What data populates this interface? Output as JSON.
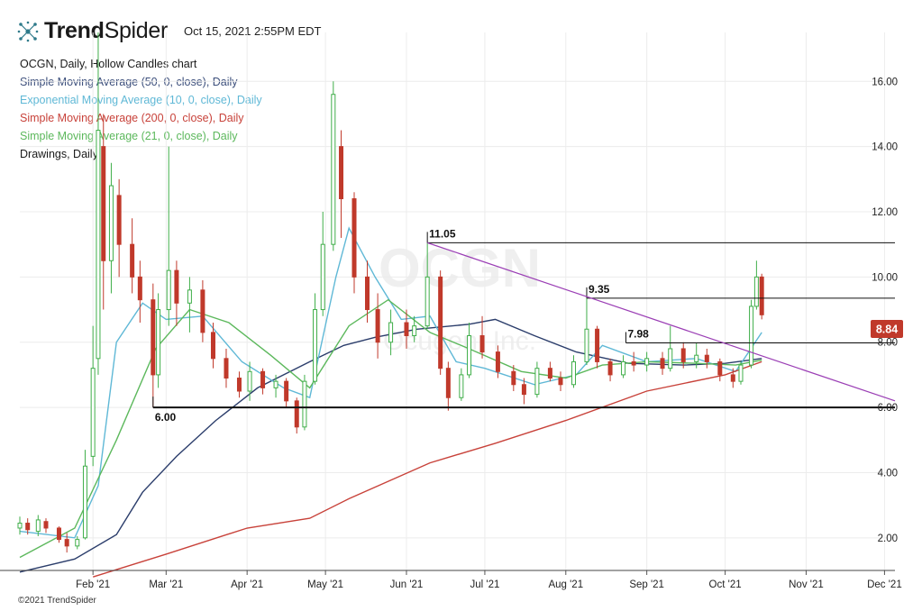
{
  "header": {
    "brand_bold": "Trend",
    "brand_light": "Spider",
    "timestamp": "Oct 15, 2021 2:55PM EDT"
  },
  "legend": [
    {
      "text": "OCGN, Daily, Hollow Candles chart",
      "color": "#1a1a1a"
    },
    {
      "text": "Simple Moving Average (50, 0, close), Daily",
      "color": "#3a4d7a"
    },
    {
      "text": "Exponential Moving Average (10, 0, close), Daily",
      "color": "#5fb8d6"
    },
    {
      "text": "Simple Moving Average (200, 0, close), Daily",
      "color": "#c8423a"
    },
    {
      "text": "Simple Moving Average (21, 0, close), Daily",
      "color": "#5cb85c"
    },
    {
      "text": "Drawings, Daily",
      "color": "#1a1a1a"
    }
  ],
  "footer": {
    "copyright": "©2021 TrendSpider"
  },
  "watermark": {
    "ticker": "OCGN",
    "company": "Ocugen, Inc."
  },
  "price_badge": {
    "value": "8.84",
    "color": "#c0392b"
  },
  "chart_data": {
    "type": "candlestick",
    "symbol": "OCGN",
    "interval": "Daily",
    "ylim": [
      1.0,
      17.5
    ],
    "y_ticks": [
      "2.00",
      "4.00",
      "6.00",
      "8.00",
      "10.00",
      "12.00",
      "14.00",
      "16.00"
    ],
    "x_range": [
      "2021-01-04",
      "2021-12-05"
    ],
    "x_ticks": [
      {
        "date": "2021-02-01",
        "label": "Feb '21"
      },
      {
        "date": "2021-03-01",
        "label": "Mar '21"
      },
      {
        "date": "2021-04-01",
        "label": "Apr '21"
      },
      {
        "date": "2021-05-01",
        "label": "May '21"
      },
      {
        "date": "2021-06-01",
        "label": "Jun '21"
      },
      {
        "date": "2021-07-01",
        "label": "Jul '21"
      },
      {
        "date": "2021-08-01",
        "label": "Aug '21"
      },
      {
        "date": "2021-09-01",
        "label": "Sep '21"
      },
      {
        "date": "2021-10-01",
        "label": "Oct '21"
      },
      {
        "date": "2021-11-01",
        "label": "Nov '21"
      },
      {
        "date": "2021-12-01",
        "label": "Dec '21"
      }
    ],
    "candles": [
      {
        "date": "2021-01-04",
        "open": 2.3,
        "high": 2.65,
        "low": 2.1,
        "close": 2.45
      },
      {
        "date": "2021-01-07",
        "open": 2.45,
        "high": 2.6,
        "low": 2.1,
        "close": 2.25
      },
      {
        "date": "2021-01-11",
        "open": 2.2,
        "high": 2.7,
        "low": 2.05,
        "close": 2.55
      },
      {
        "date": "2021-01-14",
        "open": 2.5,
        "high": 2.6,
        "low": 2.15,
        "close": 2.3
      },
      {
        "date": "2021-01-19",
        "open": 2.3,
        "high": 2.35,
        "low": 1.85,
        "close": 1.95
      },
      {
        "date": "2021-01-22",
        "open": 1.95,
        "high": 2.15,
        "low": 1.55,
        "close": 1.75
      },
      {
        "date": "2021-01-26",
        "open": 1.75,
        "high": 2.05,
        "low": 1.65,
        "close": 1.95
      },
      {
        "date": "2021-01-29",
        "open": 2.0,
        "high": 4.7,
        "low": 1.95,
        "close": 4.2
      },
      {
        "date": "2021-02-01",
        "open": 4.5,
        "high": 8.5,
        "low": 4.2,
        "close": 7.2
      },
      {
        "date": "2021-02-03",
        "open": 7.5,
        "high": 17.5,
        "low": 7.0,
        "close": 14.5
      },
      {
        "date": "2021-02-05",
        "open": 14.0,
        "high": 15.0,
        "low": 9.0,
        "close": 10.5
      },
      {
        "date": "2021-02-08",
        "open": 10.5,
        "high": 13.5,
        "low": 9.5,
        "close": 12.8
      },
      {
        "date": "2021-02-11",
        "open": 12.5,
        "high": 13.0,
        "low": 10.0,
        "close": 11.0
      },
      {
        "date": "2021-02-16",
        "open": 11.0,
        "high": 11.8,
        "low": 9.5,
        "close": 10.0
      },
      {
        "date": "2021-02-19",
        "open": 10.0,
        "high": 10.5,
        "low": 8.6,
        "close": 9.3
      },
      {
        "date": "2021-02-24",
        "open": 9.3,
        "high": 9.8,
        "low": 6.0,
        "close": 7.0
      },
      {
        "date": "2021-02-26",
        "open": 7.0,
        "high": 9.5,
        "low": 6.6,
        "close": 9.0
      },
      {
        "date": "2021-03-02",
        "open": 9.0,
        "high": 14.0,
        "low": 8.5,
        "close": 10.2
      },
      {
        "date": "2021-03-05",
        "open": 10.2,
        "high": 10.5,
        "low": 8.5,
        "close": 9.2
      },
      {
        "date": "2021-03-10",
        "open": 9.2,
        "high": 10.0,
        "low": 8.3,
        "close": 9.6
      },
      {
        "date": "2021-03-15",
        "open": 9.6,
        "high": 9.9,
        "low": 8.0,
        "close": 8.3
      },
      {
        "date": "2021-03-19",
        "open": 8.3,
        "high": 8.6,
        "low": 7.2,
        "close": 7.5
      },
      {
        "date": "2021-03-24",
        "open": 7.5,
        "high": 7.8,
        "low": 6.6,
        "close": 6.9
      },
      {
        "date": "2021-03-29",
        "open": 6.9,
        "high": 7.1,
        "low": 6.3,
        "close": 6.5
      },
      {
        "date": "2021-04-02",
        "open": 6.5,
        "high": 7.4,
        "low": 6.2,
        "close": 7.1
      },
      {
        "date": "2021-04-07",
        "open": 7.1,
        "high": 7.2,
        "low": 6.4,
        "close": 6.6
      },
      {
        "date": "2021-04-12",
        "open": 6.6,
        "high": 7.0,
        "low": 6.3,
        "close": 6.8
      },
      {
        "date": "2021-04-16",
        "open": 6.8,
        "high": 6.9,
        "low": 6.0,
        "close": 6.2
      },
      {
        "date": "2021-04-20",
        "open": 6.2,
        "high": 6.3,
        "low": 5.2,
        "close": 5.4
      },
      {
        "date": "2021-04-23",
        "open": 5.4,
        "high": 7.0,
        "low": 5.3,
        "close": 6.8
      },
      {
        "date": "2021-04-27",
        "open": 6.8,
        "high": 9.5,
        "low": 6.7,
        "close": 9.0
      },
      {
        "date": "2021-04-30",
        "open": 9.0,
        "high": 12.0,
        "low": 8.8,
        "close": 11.0
      },
      {
        "date": "2021-05-04",
        "open": 11.0,
        "high": 16.0,
        "low": 10.8,
        "close": 15.6
      },
      {
        "date": "2021-05-07",
        "open": 14.0,
        "high": 14.5,
        "low": 11.2,
        "close": 12.4
      },
      {
        "date": "2021-05-12",
        "open": 12.4,
        "high": 12.6,
        "low": 9.5,
        "close": 10.0
      },
      {
        "date": "2021-05-17",
        "open": 10.0,
        "high": 10.5,
        "low": 8.6,
        "close": 9.0
      },
      {
        "date": "2021-05-21",
        "open": 9.0,
        "high": 9.5,
        "low": 7.5,
        "close": 8.0
      },
      {
        "date": "2021-05-26",
        "open": 8.0,
        "high": 9.0,
        "low": 7.6,
        "close": 8.6
      },
      {
        "date": "2021-06-01",
        "open": 8.6,
        "high": 9.0,
        "low": 7.8,
        "close": 8.2
      },
      {
        "date": "2021-06-04",
        "open": 8.2,
        "high": 8.8,
        "low": 8.0,
        "close": 8.5
      },
      {
        "date": "2021-06-09",
        "open": 8.5,
        "high": 11.05,
        "low": 8.4,
        "close": 10.0
      },
      {
        "date": "2021-06-14",
        "open": 10.0,
        "high": 10.2,
        "low": 7.0,
        "close": 7.2
      },
      {
        "date": "2021-06-17",
        "open": 7.2,
        "high": 7.4,
        "low": 5.9,
        "close": 6.3
      },
      {
        "date": "2021-06-22",
        "open": 6.3,
        "high": 7.2,
        "low": 6.2,
        "close": 7.0
      },
      {
        "date": "2021-06-25",
        "open": 7.0,
        "high": 8.6,
        "low": 6.9,
        "close": 8.2
      },
      {
        "date": "2021-06-30",
        "open": 8.2,
        "high": 8.8,
        "low": 7.5,
        "close": 7.7
      },
      {
        "date": "2021-07-06",
        "open": 7.7,
        "high": 7.9,
        "low": 6.9,
        "close": 7.1
      },
      {
        "date": "2021-07-12",
        "open": 7.1,
        "high": 7.3,
        "low": 6.5,
        "close": 6.7
      },
      {
        "date": "2021-07-16",
        "open": 6.7,
        "high": 6.9,
        "low": 6.1,
        "close": 6.4
      },
      {
        "date": "2021-07-21",
        "open": 6.4,
        "high": 7.4,
        "low": 6.3,
        "close": 7.2
      },
      {
        "date": "2021-07-26",
        "open": 7.2,
        "high": 7.4,
        "low": 6.8,
        "close": 6.9
      },
      {
        "date": "2021-07-30",
        "open": 6.9,
        "high": 7.1,
        "low": 6.5,
        "close": 6.7
      },
      {
        "date": "2021-08-04",
        "open": 6.7,
        "high": 7.6,
        "low": 6.6,
        "close": 7.4
      },
      {
        "date": "2021-08-09",
        "open": 7.4,
        "high": 9.35,
        "low": 7.3,
        "close": 8.4
      },
      {
        "date": "2021-08-13",
        "open": 8.4,
        "high": 8.5,
        "low": 7.2,
        "close": 7.4
      },
      {
        "date": "2021-08-18",
        "open": 7.4,
        "high": 7.5,
        "low": 6.8,
        "close": 7.0
      },
      {
        "date": "2021-08-23",
        "open": 7.0,
        "high": 7.6,
        "low": 6.9,
        "close": 7.4
      },
      {
        "date": "2021-08-27",
        "open": 7.4,
        "high": 7.7,
        "low": 7.1,
        "close": 7.3
      },
      {
        "date": "2021-09-01",
        "open": 7.3,
        "high": 7.7,
        "low": 7.1,
        "close": 7.5
      },
      {
        "date": "2021-09-07",
        "open": 7.5,
        "high": 7.7,
        "low": 7.0,
        "close": 7.2
      },
      {
        "date": "2021-09-10",
        "open": 7.2,
        "high": 8.5,
        "low": 7.1,
        "close": 7.8
      },
      {
        "date": "2021-09-15",
        "open": 7.8,
        "high": 8.0,
        "low": 7.2,
        "close": 7.4
      },
      {
        "date": "2021-09-20",
        "open": 7.4,
        "high": 7.98,
        "low": 7.2,
        "close": 7.6
      },
      {
        "date": "2021-09-24",
        "open": 7.6,
        "high": 7.8,
        "low": 7.2,
        "close": 7.4
      },
      {
        "date": "2021-09-29",
        "open": 7.4,
        "high": 7.5,
        "low": 6.8,
        "close": 7.0
      },
      {
        "date": "2021-10-04",
        "open": 7.0,
        "high": 7.2,
        "low": 6.6,
        "close": 6.8
      },
      {
        "date": "2021-10-07",
        "open": 6.8,
        "high": 7.4,
        "low": 6.7,
        "close": 7.3
      },
      {
        "date": "2021-10-11",
        "open": 7.3,
        "high": 9.3,
        "low": 7.2,
        "close": 9.1
      },
      {
        "date": "2021-10-13",
        "open": 9.1,
        "high": 10.5,
        "low": 9.0,
        "close": 10.0
      },
      {
        "date": "2021-10-15",
        "open": 10.0,
        "high": 10.1,
        "low": 8.7,
        "close": 8.84
      }
    ],
    "series": [
      {
        "kind": "sma50",
        "color": "#2b3d6b",
        "points": [
          [
            "2021-01-04",
            0.95
          ],
          [
            "2021-01-25",
            1.35
          ],
          [
            "2021-02-10",
            2.1
          ],
          [
            "2021-02-20",
            3.4
          ],
          [
            "2021-03-05",
            4.5
          ],
          [
            "2021-03-20",
            5.6
          ],
          [
            "2021-04-05",
            6.6
          ],
          [
            "2021-04-25",
            7.4
          ],
          [
            "2021-05-08",
            7.9
          ],
          [
            "2021-05-20",
            8.15
          ],
          [
            "2021-06-05",
            8.4
          ],
          [
            "2021-06-25",
            8.55
          ],
          [
            "2021-07-05",
            8.7
          ],
          [
            "2021-07-20",
            8.2
          ],
          [
            "2021-08-05",
            7.7
          ],
          [
            "2021-08-25",
            7.35
          ],
          [
            "2021-09-15",
            7.3
          ],
          [
            "2021-10-01",
            7.35
          ],
          [
            "2021-10-15",
            7.5
          ]
        ]
      },
      {
        "kind": "ema10",
        "color": "#5fb8d6",
        "points": [
          [
            "2021-01-04",
            2.2
          ],
          [
            "2021-01-25",
            2.0
          ],
          [
            "2021-02-03",
            3.6
          ],
          [
            "2021-02-10",
            8.0
          ],
          [
            "2021-02-20",
            9.2
          ],
          [
            "2021-03-01",
            8.7
          ],
          [
            "2021-03-15",
            8.8
          ],
          [
            "2021-03-30",
            7.4
          ],
          [
            "2021-04-15",
            6.6
          ],
          [
            "2021-04-25",
            6.3
          ],
          [
            "2021-05-05",
            10.0
          ],
          [
            "2021-05-10",
            11.5
          ],
          [
            "2021-05-20",
            10.0
          ],
          [
            "2021-05-30",
            8.7
          ],
          [
            "2021-06-10",
            8.8
          ],
          [
            "2021-06-20",
            7.4
          ],
          [
            "2021-07-01",
            7.2
          ],
          [
            "2021-07-20",
            6.7
          ],
          [
            "2021-08-05",
            7.0
          ],
          [
            "2021-08-15",
            7.9
          ],
          [
            "2021-09-01",
            7.4
          ],
          [
            "2021-09-20",
            7.5
          ],
          [
            "2021-10-05",
            7.1
          ],
          [
            "2021-10-15",
            8.3
          ]
        ]
      },
      {
        "kind": "sma200",
        "color": "#c8423a",
        "points": [
          [
            "2021-02-01",
            0.8
          ],
          [
            "2021-03-01",
            1.5
          ],
          [
            "2021-04-01",
            2.3
          ],
          [
            "2021-04-25",
            2.6
          ],
          [
            "2021-05-10",
            3.2
          ],
          [
            "2021-06-10",
            4.3
          ],
          [
            "2021-07-05",
            4.9
          ],
          [
            "2021-08-01",
            5.6
          ],
          [
            "2021-09-01",
            6.5
          ],
          [
            "2021-10-01",
            7.0
          ],
          [
            "2021-10-15",
            7.4
          ]
        ]
      },
      {
        "kind": "sma21",
        "color": "#5cb85c",
        "points": [
          [
            "2021-01-04",
            1.4
          ],
          [
            "2021-01-25",
            2.3
          ],
          [
            "2021-02-10",
            5.0
          ],
          [
            "2021-02-25",
            7.8
          ],
          [
            "2021-03-10",
            9.0
          ],
          [
            "2021-03-25",
            8.6
          ],
          [
            "2021-04-10",
            7.6
          ],
          [
            "2021-04-25",
            6.6
          ],
          [
            "2021-05-10",
            8.5
          ],
          [
            "2021-05-25",
            9.3
          ],
          [
            "2021-06-10",
            8.3
          ],
          [
            "2021-06-25",
            7.8
          ],
          [
            "2021-07-15",
            7.1
          ],
          [
            "2021-08-01",
            6.9
          ],
          [
            "2021-08-15",
            7.3
          ],
          [
            "2021-09-01",
            7.4
          ],
          [
            "2021-09-20",
            7.35
          ],
          [
            "2021-10-05",
            7.3
          ],
          [
            "2021-10-15",
            7.45
          ]
        ]
      }
    ],
    "drawings": [
      {
        "kind": "hline",
        "price": 11.05,
        "from": "2021-06-09",
        "label": "11.05"
      },
      {
        "kind": "hline",
        "price": 9.35,
        "from": "2021-08-09",
        "label": "9.35"
      },
      {
        "kind": "hline",
        "price": 7.98,
        "from": "2021-08-24",
        "label": "7.98"
      },
      {
        "kind": "hline",
        "price": 6.0,
        "from": "2021-02-24",
        "label": "6.00"
      },
      {
        "kind": "trendline",
        "from": [
          "2021-06-09",
          11.05
        ],
        "to": [
          "2021-12-05",
          6.2
        ],
        "color": "#9b3fb5"
      }
    ]
  }
}
